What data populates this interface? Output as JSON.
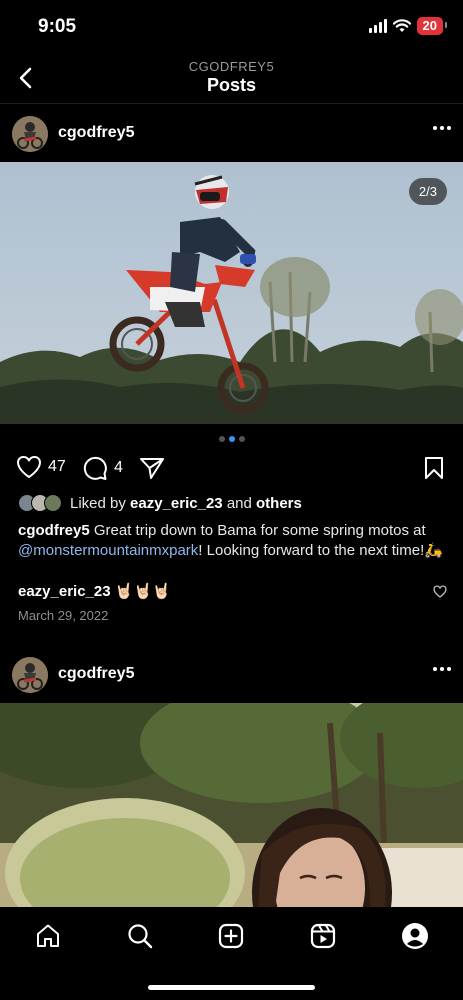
{
  "status_bar": {
    "time": "9:05",
    "battery": "20"
  },
  "header": {
    "subtitle": "CGODFREY5",
    "title": "Posts"
  },
  "posts": [
    {
      "username": "cgodfrey5",
      "page_indicator": "2/3",
      "likes_count": "47",
      "comments_count": "4",
      "liked_by_prefix": "Liked by",
      "liked_by_user": "eazy_eric_23",
      "liked_by_and": "and",
      "liked_by_others": "others",
      "caption_user": "cgodfrey5",
      "caption_text_1": "Great trip down to Bama for some spring motos at",
      "caption_mention": "@monstermountainmxpark",
      "caption_text_2": "! Looking forward to the next time!🛵",
      "comment_user": "eazy_eric_23",
      "comment_text": "🤘🏻🤘🏻🤘🏻",
      "date": "March 29, 2022"
    },
    {
      "username": "cgodfrey5"
    }
  ],
  "icons": {
    "back": "chevron-left-icon",
    "more": "more-horizontal-icon",
    "like": "heart-icon",
    "comment": "comment-icon",
    "share": "send-icon",
    "save": "bookmark-icon",
    "tabs": [
      "home-icon",
      "search-icon",
      "create-icon",
      "reels-icon",
      "profile-icon"
    ]
  },
  "colors": {
    "background": "#000000",
    "accent": "#3897f0",
    "mention": "#8fb8ee",
    "battery": "#e0333a"
  }
}
